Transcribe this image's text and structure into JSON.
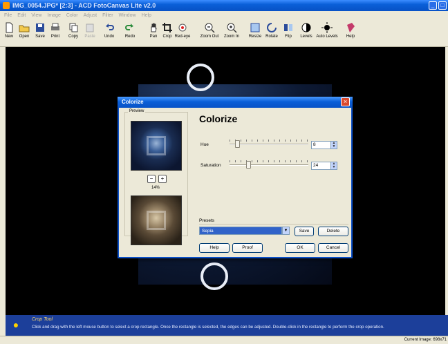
{
  "window": {
    "title": "IMG_0054.JPG* [2:3] - ACD FotoCanvas Lite v2.0"
  },
  "menu": [
    "File",
    "Edit",
    "View",
    "Image",
    "Color",
    "Adjust",
    "Filter",
    "Window",
    "Help"
  ],
  "toolbar": {
    "new": "New",
    "open": "Open",
    "save": "Save",
    "print": "Print",
    "copy": "Copy",
    "paste": "Paste",
    "undo": "Undo",
    "redo": "Redo",
    "pan": "Pan",
    "crop": "Crop",
    "redeye": "Red-eye",
    "zoomout": "Zoom Out",
    "zoomin": "Zoom In",
    "resize": "Resize",
    "rotate": "Rotate",
    "flip": "Flip",
    "levels": "Levels",
    "autolevels": "Auto Levels",
    "help": "Help"
  },
  "dialog": {
    "title": "Colorize",
    "heading": "Colorize",
    "preview_label": "Preview",
    "zoom_percent": "14%",
    "hue_label": "Hue",
    "hue_value": "8",
    "saturation_label": "Saturation",
    "saturation_value": "24",
    "presets_label": "Presets",
    "preset_selected": "Sepia",
    "save": "Save",
    "delete": "Delete",
    "help": "Help",
    "proof": "Proof",
    "ok": "OK",
    "cancel": "Cancel"
  },
  "hint": {
    "title": "Crop Tool",
    "text": "Click and drag with the left mouse button to select a crop rectangle.  Once the rectangle is selected, the edges can be adjusted.  Double-click in the rectangle to perform the crop operation."
  },
  "status": {
    "current_image": "Current Image: 698x71"
  }
}
